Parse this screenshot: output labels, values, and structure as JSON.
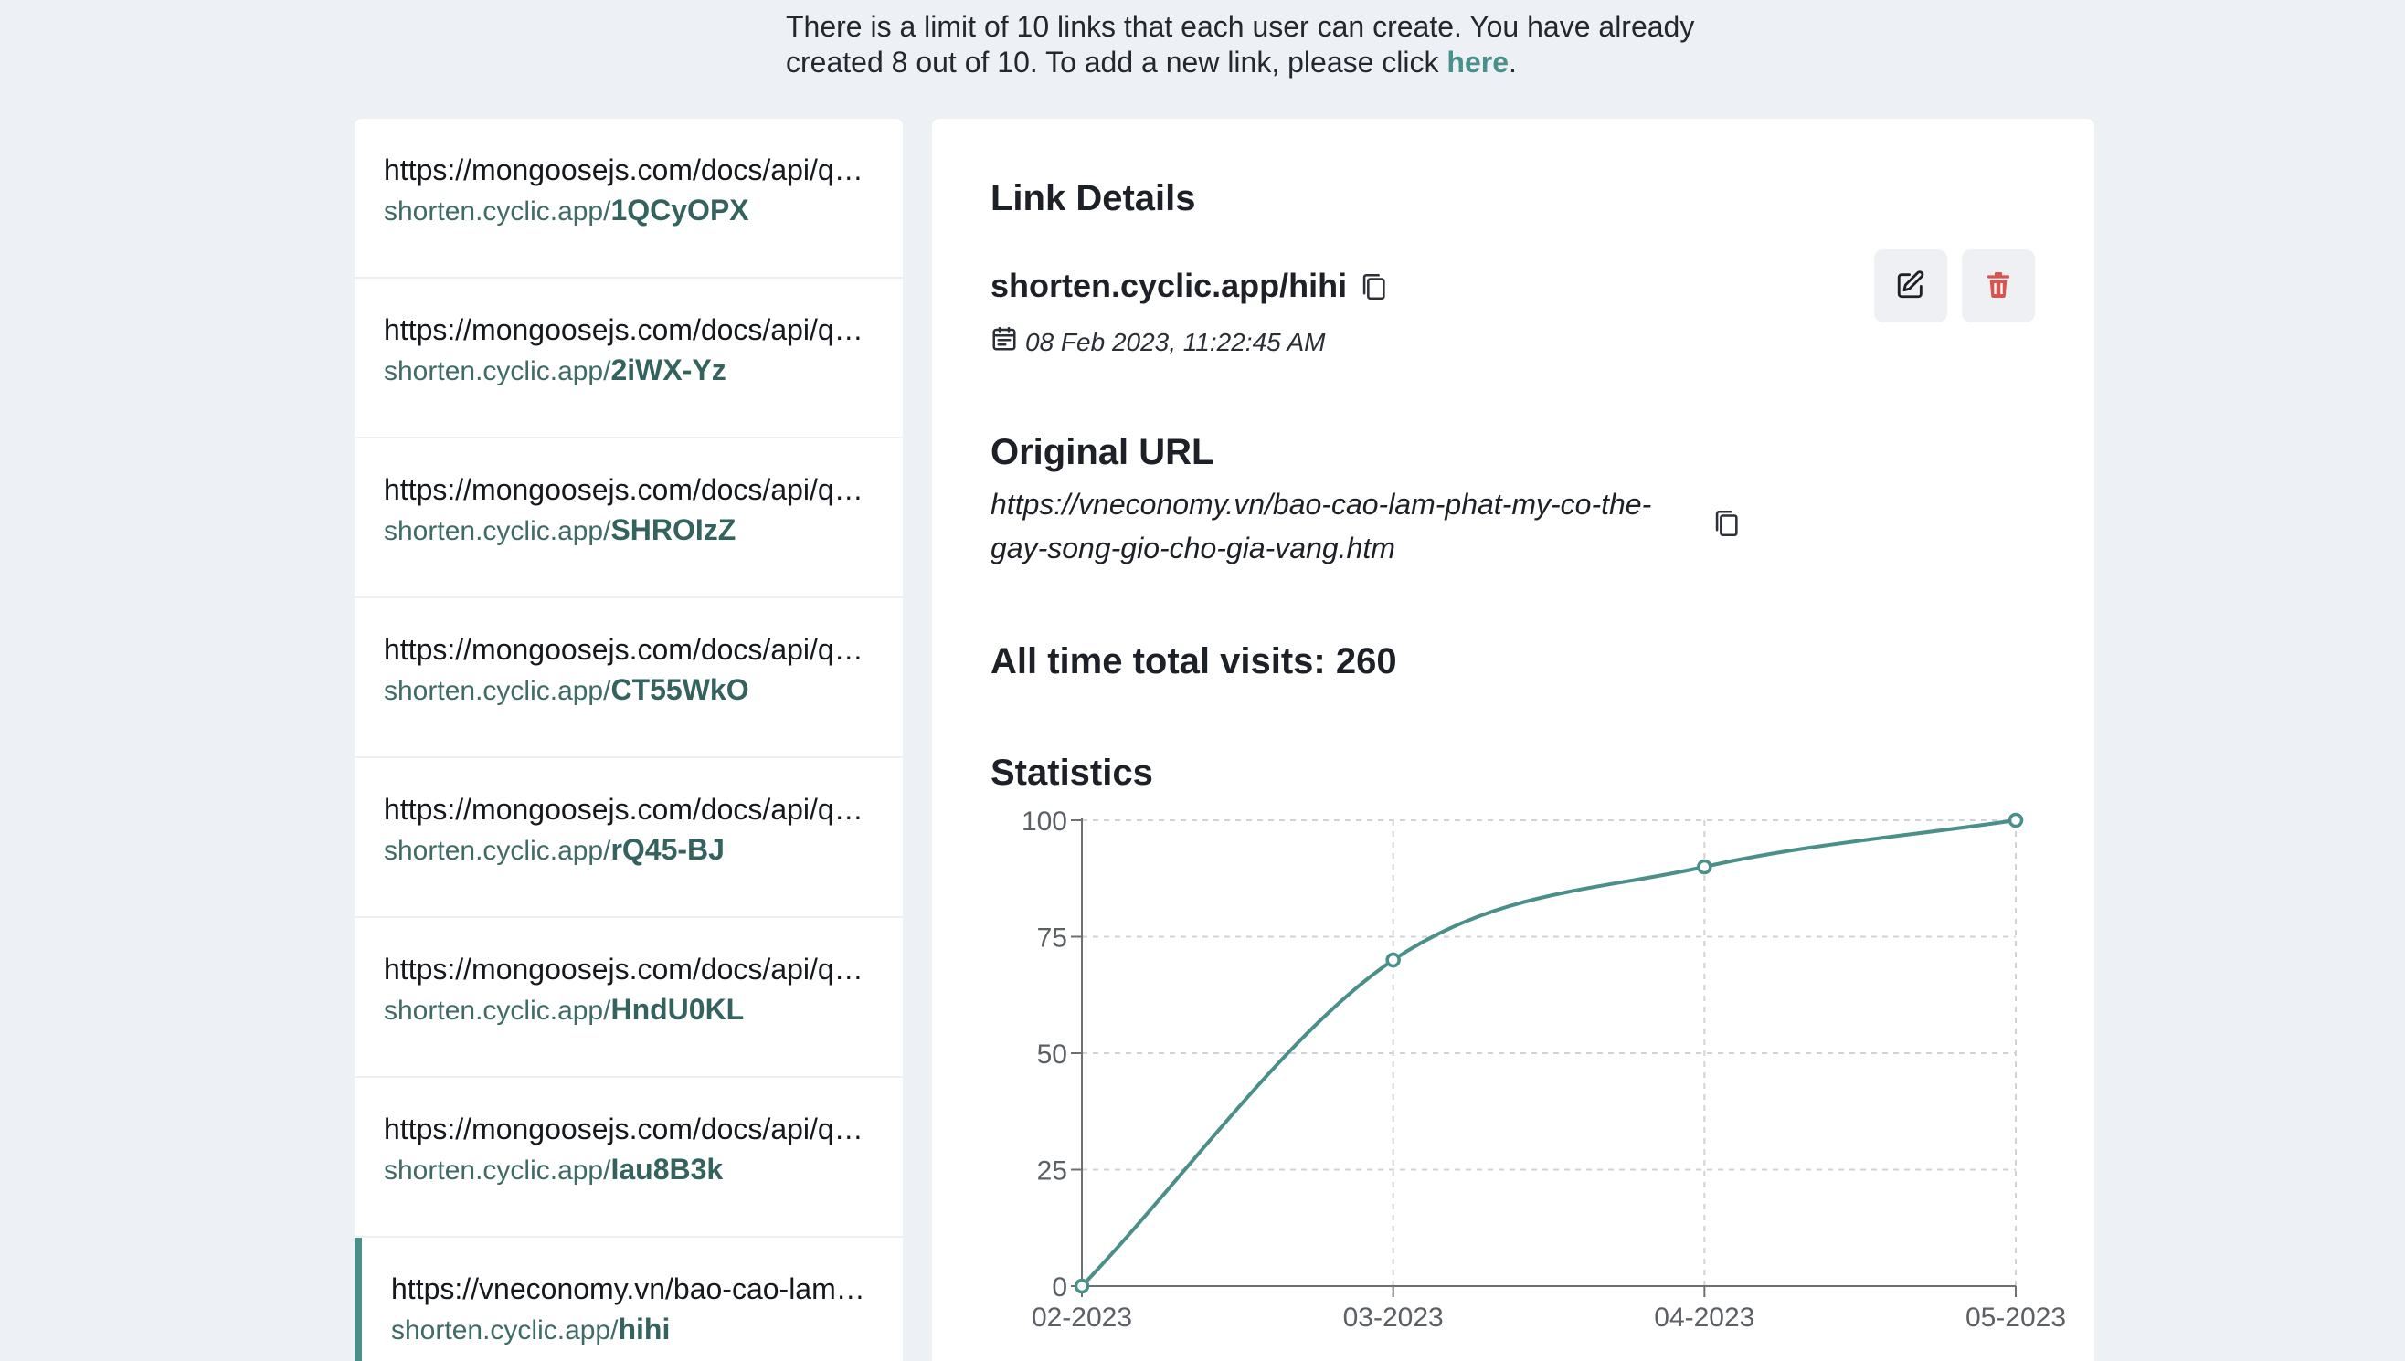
{
  "notice": {
    "text_before": "There is a limit of 10 links that each user can create. You have already created 8 out of 10. To add a new link, please click ",
    "link_label": "here",
    "text_after": "."
  },
  "links": [
    {
      "original": "https://mongoosejs.com/docs/api/query.html",
      "domain": "shorten.cyclic.app/",
      "code": "1QCyOPX"
    },
    {
      "original": "https://mongoosejs.com/docs/api/query.html",
      "domain": "shorten.cyclic.app/",
      "code": "2iWX-Yz"
    },
    {
      "original": "https://mongoosejs.com/docs/api/query.html",
      "domain": "shorten.cyclic.app/",
      "code": "SHROIzZ"
    },
    {
      "original": "https://mongoosejs.com/docs/api/query.html",
      "domain": "shorten.cyclic.app/",
      "code": "CT55WkO"
    },
    {
      "original": "https://mongoosejs.com/docs/api/query.html",
      "domain": "shorten.cyclic.app/",
      "code": "rQ45-BJ"
    },
    {
      "original": "https://mongoosejs.com/docs/api/query.html",
      "domain": "shorten.cyclic.app/",
      "code": "HndU0KL"
    },
    {
      "original": "https://mongoosejs.com/docs/api/query.html",
      "domain": "shorten.cyclic.app/",
      "code": "Iau8B3k"
    },
    {
      "original": "https://vneconomy.vn/bao-cao-lam-phat-my-co-the-gay-song-gio-cho-gia-vang.htm",
      "domain": "shorten.cyclic.app/",
      "code": "hihi"
    }
  ],
  "details": {
    "heading": "Link Details",
    "short_url": "shorten.cyclic.app/hihi",
    "created": "08 Feb 2023, 11:22:45 AM",
    "original_heading": "Original URL",
    "original_url": "https://vneconomy.vn/bao-cao-lam-phat-my-co-the-gay-song-gio-cho-gia-vang.htm",
    "visits_label": "All time total visits: 260",
    "stats_heading": "Statistics"
  },
  "colors": {
    "accent": "#4a8f89",
    "delete": "#d9534f",
    "background": "#edf1f6"
  },
  "chart_data": {
    "type": "line",
    "categories": [
      "02-2023",
      "03-2023",
      "04-2023",
      "05-2023"
    ],
    "values": [
      0,
      70,
      90,
      100
    ],
    "yticks": [
      0,
      25,
      50,
      75,
      100
    ],
    "ylim": [
      0,
      100
    ],
    "grid": true,
    "title": "",
    "xlabel": "",
    "ylabel": ""
  }
}
